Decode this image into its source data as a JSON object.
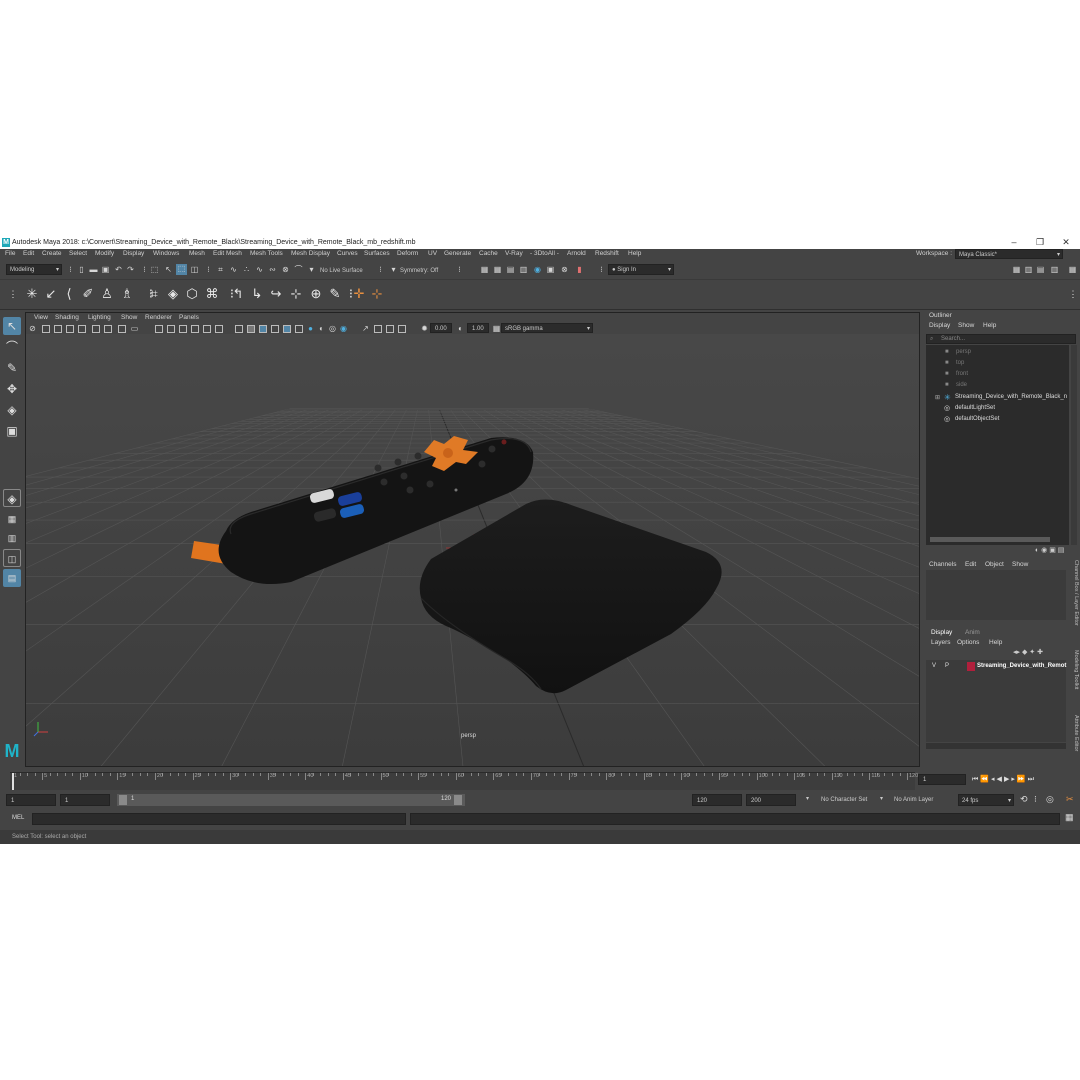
{
  "app": {
    "title": "Autodesk Maya 2018: c:\\Convert\\Streaming_Device_with_Remote_Black\\Streaming_Device_with_Remote_Black_mb_redshift.mb",
    "logo_letter": "M",
    "window_controls": [
      "–",
      "❐",
      "✕"
    ]
  },
  "menu": [
    "File",
    "Edit",
    "Create",
    "Select",
    "Modify",
    "Display",
    "Windows",
    "Mesh",
    "Edit Mesh",
    "Mesh Tools",
    "Mesh Display",
    "Curves",
    "Surfaces",
    "Deform",
    "UV",
    "Generate",
    "Cache",
    "V-Ray",
    "- 3DtoAll -",
    "Arnold",
    "Redshift",
    "Help"
  ],
  "workspace": {
    "label": "Workspace :",
    "value": "Maya Classic*"
  },
  "status": {
    "mode": "Modeling",
    "live_surface": "No Live Surface",
    "symmetry": "Symmetry: Off",
    "sign_in": "Sign In"
  },
  "viewport": {
    "menu": [
      "View",
      "Shading",
      "Lighting",
      "Show",
      "Renderer",
      "Panels"
    ],
    "exposure": "0.00",
    "gamma": "1.00",
    "color_space": "sRGB gamma",
    "camera_label": "persp"
  },
  "outliner": {
    "title": "Outliner",
    "menu": [
      "Display",
      "Show",
      "Help"
    ],
    "search_placeholder": "Search...",
    "items": [
      "persp",
      "top",
      "front",
      "side",
      "Streaming_Device_with_Remote_Black_n",
      "defaultLightSet",
      "defaultObjectSet"
    ]
  },
  "channel_box": {
    "menu": [
      "Channels",
      "Edit",
      "Object",
      "Show"
    ],
    "side_tabs": [
      "Channel Box / Layer Editor",
      "Modeling Toolkit",
      "Attribute Editor"
    ]
  },
  "layer_editor": {
    "tabs": [
      "Display",
      "Anim"
    ],
    "menu": [
      "Layers",
      "Options",
      "Help"
    ],
    "layer": {
      "v": "V",
      "p": "P",
      "name": "Streaming_Device_with_Remot",
      "color": "#b01f3c"
    }
  },
  "timeline": {
    "ticks": [
      "1",
      "5",
      "10",
      "15",
      "20",
      "25",
      "30",
      "35",
      "40",
      "45",
      "50",
      "55",
      "60",
      "65",
      "70",
      "75",
      "80",
      "85",
      "90",
      "95",
      "100",
      "105",
      "110",
      "115",
      "120"
    ],
    "current_frame": "1"
  },
  "range": {
    "start": "1",
    "start_inner": "1",
    "slider_start": "1",
    "slider_end": "120",
    "end_inner": "120",
    "end": "200",
    "character_set": "No Character Set",
    "anim_layer": "No Anim Layer",
    "fps": "24 fps"
  },
  "command": {
    "label": "MEL"
  },
  "help_line": "Select Tool: select an object",
  "colors": {
    "ui_bg": "#444444",
    "viewport_bg": "#3f3f3f",
    "accent_blue": "#5285a6",
    "remote_orange": "#e0741e"
  }
}
